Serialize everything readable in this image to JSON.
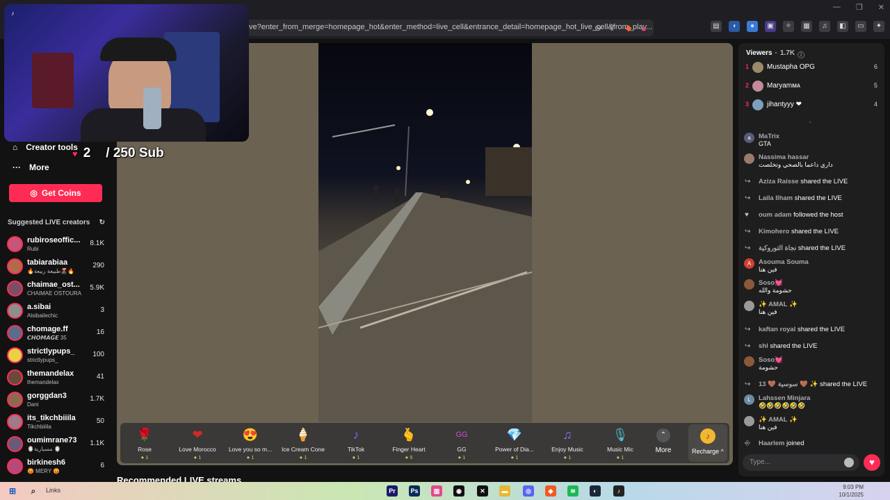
{
  "browser": {
    "url": "ve?enter_from_merge=homepage_hot&enter_method=live_cell&entrance_detail=homepage_hot_live_cell&from_play..."
  },
  "sidebar": {
    "creator_tools": "Creator tools",
    "more": "More",
    "get_coins": "Get Coins",
    "suggested_title": "Suggested LIVE creators",
    "creators": [
      {
        "name": "rubiroseoffic...",
        "sub": "Rubi",
        "count": "8.1K",
        "color": "#c2577a"
      },
      {
        "name": "tabiarabiaa",
        "sub": "🔥طبيعة ربيعة🌋🔥",
        "count": "290",
        "color": "#b36a4a"
      },
      {
        "name": "chaimae_ost...",
        "sub": "CHAIMAE OSTOURA",
        "count": "5.9K",
        "color": "#7a4f66"
      },
      {
        "name": "a.sibai",
        "sub": "Alsibailechic",
        "count": "3",
        "color": "#8e8e8e"
      },
      {
        "name": "chomage.ff",
        "sub": "𝘾𝙃𝙊𝙈𝘼𝙂𝙀 35",
        "count": "16",
        "color": "#5a6d8a"
      },
      {
        "name": "strictlypups_",
        "sub": "strictlypups_",
        "count": "100",
        "color": "#e8d244"
      },
      {
        "name": "themandelax",
        "sub": "themandelax",
        "count": "41",
        "color": "#6a4a3a"
      },
      {
        "name": "gorggdan3",
        "sub": "Dani",
        "count": "1.7K",
        "color": "#8c6a52"
      },
      {
        "name": "its_tikchbiiila",
        "sub": "Tikchbiiila",
        "count": "50",
        "color": "#a07a8a"
      },
      {
        "name": "oumimrane73",
        "sub": "🪞مسيارية 🪞",
        "count": "1.1K",
        "color": "#6a5a7a"
      },
      {
        "name": "birkinesh6",
        "sub": "😡 MERY 😡",
        "count": "6",
        "color": "#b44a7a"
      }
    ]
  },
  "stage": {
    "sub_goal_count": "2",
    "sub_goal_text": "/ 250 Sub"
  },
  "gifts": [
    {
      "name": "Rose",
      "price": "1",
      "icon": "🌹",
      "color": "#c21f3a"
    },
    {
      "name": "Love Morocco",
      "price": "1",
      "icon": "❤",
      "color": "#d12a2a"
    },
    {
      "name": "Love you so m...",
      "price": "1",
      "icon": "😍",
      "color": "#e34b6a"
    },
    {
      "name": "Ice Cream Cone",
      "price": "1",
      "icon": "🍦",
      "color": "#f2b6c8"
    },
    {
      "name": "TikTok",
      "price": "1",
      "icon": "♪",
      "color": "#7a6af0"
    },
    {
      "name": "Finger Heart",
      "price": "5",
      "icon": "🫰",
      "color": "#e5a080"
    },
    {
      "name": "GG",
      "price": "1",
      "icon": "GG",
      "color": "#d04bd0"
    },
    {
      "name": "Power of Dia...",
      "price": "1",
      "icon": "💎",
      "color": "#e8c46a"
    },
    {
      "name": "Enjoy Music",
      "price": "1",
      "icon": "♫",
      "color": "#8a6af0"
    },
    {
      "name": "Music Mic",
      "price": "1",
      "icon": "🎙",
      "color": "#4fc0d0"
    }
  ],
  "gift_controls": {
    "more": "More",
    "recharge": "Recharge ^"
  },
  "recommended_title": "Recommended LIVE streams",
  "chat": {
    "viewers_label": "Viewers",
    "viewers_count": "1.7K",
    "top_viewers": [
      {
        "rank": "1",
        "name": "Mustapha OPG",
        "score": "6",
        "color": "#9a8a6a"
      },
      {
        "rank": "2",
        "name": "Maryamᴍᴀ",
        "score": "5",
        "color": "#c48a9a"
      },
      {
        "rank": "3",
        "name": "jihantyyy ❤",
        "score": "4",
        "color": "#7aa0c0"
      }
    ],
    "messages": [
      {
        "kind": "comment",
        "user": "MaTrix",
        "text": "GTA",
        "avatar": "a",
        "color": "#5a5a7a"
      },
      {
        "kind": "comment",
        "user": "Nassima hassar",
        "text": "داري داعما بالصحي وتخلصت",
        "avatar": "",
        "color": "#9a7a6a"
      },
      {
        "kind": "event",
        "user": "Aziza Raisse",
        "text": "shared the LIVE"
      },
      {
        "kind": "event",
        "user": "Laila Ilham",
        "text": "shared the LIVE"
      },
      {
        "kind": "event",
        "user": "oum adam",
        "text": "followed the host"
      },
      {
        "kind": "event",
        "user": "Kimohero",
        "text": "shared the LIVE"
      },
      {
        "kind": "event",
        "user": "نجاة التوروكية",
        "text": "shared the LIVE"
      },
      {
        "kind": "comment",
        "user": "Asouma Souma",
        "text": "فين هنا",
        "avatar": "A",
        "color": "#d04030"
      },
      {
        "kind": "comment",
        "user": "Soso💓",
        "text": "حشومة والله",
        "avatar": "",
        "color": "#8a5a3a"
      },
      {
        "kind": "comment",
        "user": "✨ AMAL ✨",
        "text": "فين هنا",
        "avatar": "",
        "color": "#9a9a9a"
      },
      {
        "kind": "event",
        "user": "kaftan royal",
        "text": "shared the LIVE"
      },
      {
        "kind": "event",
        "user": "shl",
        "text": "shared the LIVE"
      },
      {
        "kind": "comment",
        "user": "Soso💓",
        "text": "حشومة",
        "avatar": "",
        "color": "#8a5a3a"
      },
      {
        "kind": "event",
        "user": "13 🤎 سوسية 🤎 ✨",
        "text": "shared the LIVE"
      },
      {
        "kind": "comment",
        "user": "Lahssen Minjara",
        "text": "🤣🤣🤣🤣🤣🤣",
        "avatar": "L",
        "color": "#6a8aa0"
      },
      {
        "kind": "comment",
        "user": "✨ AMAL ✨",
        "text": "فين هنا",
        "avatar": "",
        "color": "#9a9a9a"
      },
      {
        "kind": "event",
        "user": "Haarlem",
        "text": "joined"
      }
    ],
    "input_placeholder": "Type..."
  },
  "taskbar": {
    "search_label": "Links",
    "time": "9:03 PM",
    "date": "10/1/2025"
  }
}
